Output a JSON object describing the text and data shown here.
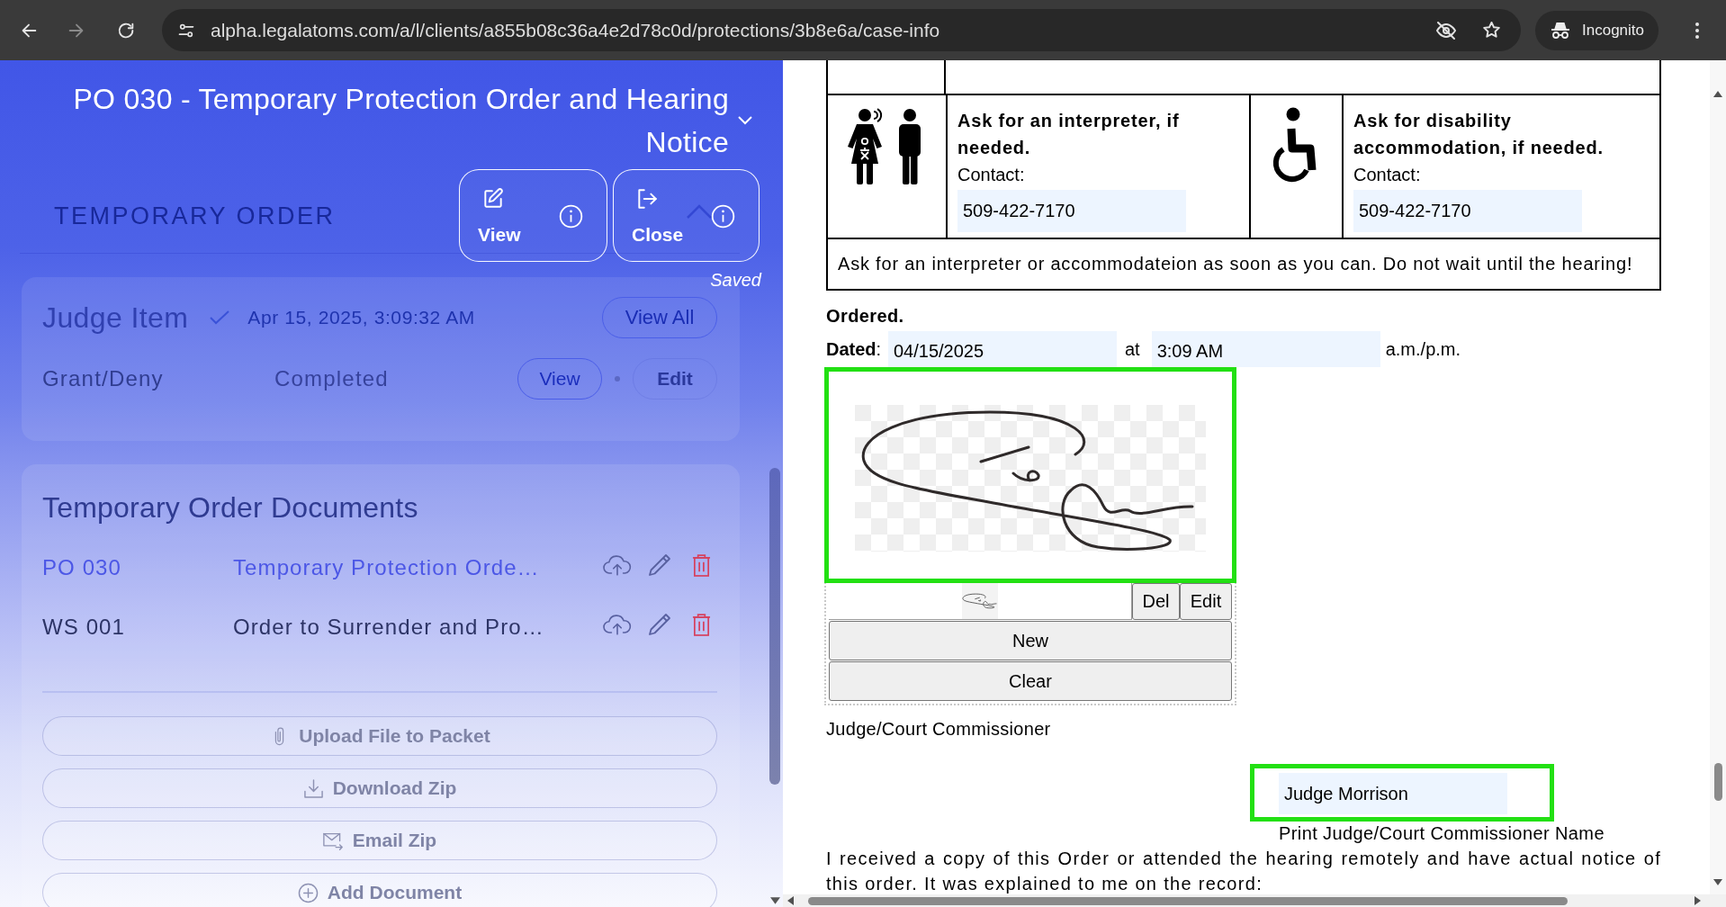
{
  "browser": {
    "url": "alpha.legalatoms.com/a/l/clients/a855b08c36a4e2d78c0d/protections/3b8e6a/case-info",
    "forward_disabled": true,
    "profile_label": "Incognito"
  },
  "sidebar": {
    "title": "PO 030 - Temporary Protection Order and Hearing Notice",
    "section": {
      "heading": "TEMPORARY ORDER",
      "expanded": true
    },
    "actions": [
      {
        "label": "View",
        "kind": "edit"
      },
      {
        "label": "Close",
        "kind": "exit"
      }
    ],
    "save_status": "Saved",
    "judge_item": {
      "title": "Judge Item",
      "done": true,
      "timestamp": "Apr 15, 2025, 3:09:32 AM",
      "view_all": "View All",
      "tasks": [
        {
          "name": "Grant/Deny",
          "status": "Completed",
          "actions": [
            {
              "label": "View",
              "kind": "outlined"
            },
            {
              "label": "Edit",
              "kind": "plain"
            }
          ]
        }
      ]
    },
    "documents": {
      "heading": "Temporary Order Documents",
      "rows": [
        {
          "code": "PO 030",
          "name": "Temporary Protection Orde…",
          "selected": true
        },
        {
          "code": "WS 001",
          "name": "Order to Surrender and Pro…",
          "selected": false
        }
      ],
      "buttons": [
        {
          "label": "Upload File to Packet",
          "kind": "attach"
        },
        {
          "label": "Download Zip",
          "kind": "download"
        },
        {
          "label": "Email Zip",
          "kind": "email"
        },
        {
          "label": "Add Document",
          "kind": "add"
        }
      ]
    }
  },
  "document": {
    "access_table": {
      "cells": [
        {
          "kind": "interpreter",
          "heading": "Ask for an interpreter, if needed.",
          "contact_label": "Contact:",
          "phone": "509-422-7170"
        },
        {
          "kind": "disability",
          "heading": "Ask for disability accommodation, if needed.",
          "contact_label": "Contact:",
          "phone": "509-422-7170"
        }
      ],
      "note": "Ask for an interpreter or accommodateion as soon as you can. Do not wait until the hearing!"
    },
    "ordered": "Ordered.",
    "dated": {
      "label": "**Dated**:",
      "date": "04/15/2025",
      "at": "at",
      "time": "3:09 AM",
      "suffix": "a.m./p.m."
    },
    "signature": {
      "highlighted": true,
      "item_buttons": [
        "Del",
        "Edit"
      ],
      "buttons": [
        "New",
        "Clear"
      ],
      "caption": "Judge/Court Commissioner"
    },
    "printed_name": {
      "value": "Judge Morrison",
      "highlighted": true,
      "caption": "Print Judge/Court Commissioner Name"
    },
    "acknowledgement": "I received a copy of this Order or attended the hearing remotely and have actual notice of this order. It was explained to me on the record:"
  }
}
